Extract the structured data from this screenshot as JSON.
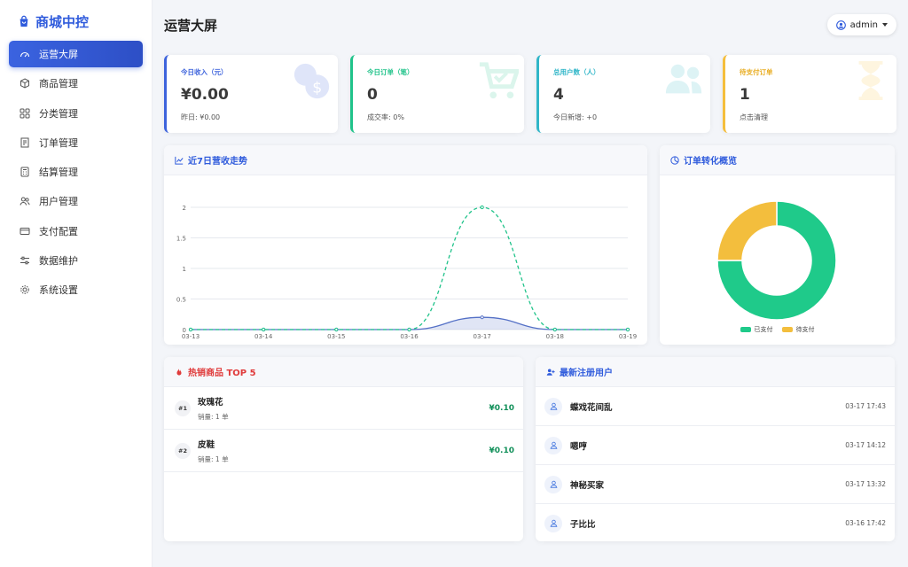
{
  "brand": {
    "title": "商城中控"
  },
  "sidebar": {
    "items": [
      {
        "label": "运营大屏",
        "icon": "dashboard-icon",
        "active": true
      },
      {
        "label": "商品管理",
        "icon": "box-icon"
      },
      {
        "label": "分类管理",
        "icon": "grid-icon"
      },
      {
        "label": "订单管理",
        "icon": "receipt-icon"
      },
      {
        "label": "结算管理",
        "icon": "calculator-icon"
      },
      {
        "label": "用户管理",
        "icon": "users-icon"
      },
      {
        "label": "支付配置",
        "icon": "credit-card-icon"
      },
      {
        "label": "数据维护",
        "icon": "sliders-icon"
      },
      {
        "label": "系统设置",
        "icon": "gear-icon"
      }
    ]
  },
  "header": {
    "title": "运营大屏",
    "user": "admin"
  },
  "stats": [
    {
      "label": "今日收入（元）",
      "value": "¥0.00",
      "sub": "昨日: ¥0.00",
      "color": "#3d63dc",
      "icon": "coins-icon"
    },
    {
      "label": "今日订单（笔）",
      "value": "0",
      "sub": "成交率: 0%",
      "color": "#20c38a",
      "icon": "cart-icon"
    },
    {
      "label": "总用户数（人）",
      "value": "4",
      "sub": "今日新增: +0",
      "color": "#30b6c8",
      "icon": "users-icon"
    },
    {
      "label": "待支付订单",
      "value": "1",
      "sub": "点击清理",
      "color": "#f5be3c",
      "icon": "hourglass-icon"
    }
  ],
  "trend_panel": {
    "title": "近7日营收走势"
  },
  "donut_panel": {
    "title": "订单转化概览"
  },
  "top_panel": {
    "title": "热销商品 TOP 5",
    "items": [
      {
        "rank": "#1",
        "name": "玫瑰花",
        "sales": "销量: 1 单",
        "price": "¥0.10"
      },
      {
        "rank": "#2",
        "name": "皮鞋",
        "sales": "销量: 1 单",
        "price": "¥0.10"
      }
    ]
  },
  "users_panel": {
    "title": "最新注册用户",
    "items": [
      {
        "name": "蝶戏花间乱",
        "time": "03-17 17:43"
      },
      {
        "name": "嗯哼",
        "time": "03-17 14:12"
      },
      {
        "name": "神秘买家",
        "time": "03-17 13:32"
      },
      {
        "name": "子比比",
        "time": "03-16 17:42"
      }
    ]
  },
  "chart_data": [
    {
      "type": "line",
      "title": "近7日营收走势",
      "categories": [
        "03-13",
        "03-14",
        "03-15",
        "03-16",
        "03-17",
        "03-18",
        "03-19"
      ],
      "yticks": [
        "0",
        "0.5",
        "1",
        "1.5",
        "2"
      ],
      "ylim": [
        0,
        2
      ],
      "series": [
        {
          "values": [
            0,
            0,
            0,
            0,
            0.2,
            0,
            0
          ],
          "color": "#5470c6",
          "style": "solid-area"
        },
        {
          "values": [
            0,
            0,
            0,
            0,
            2,
            0,
            0
          ],
          "color": "#20c38a",
          "style": "dashed"
        }
      ],
      "grid": true
    },
    {
      "type": "pie",
      "title": "订单转化概览",
      "series": [
        {
          "name": "已支付",
          "value": 3,
          "color": "#1fca8a"
        },
        {
          "name": "待支付",
          "value": 1,
          "color": "#f3be3d"
        }
      ],
      "legend": "bottom"
    }
  ]
}
